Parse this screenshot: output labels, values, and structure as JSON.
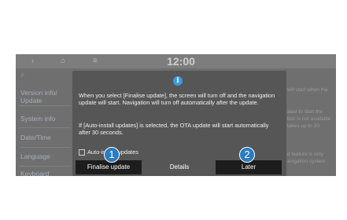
{
  "topbar": {
    "clock": "12:00",
    "back_icon": "chevron-left-icon",
    "home_icon": "home-icon",
    "menu_icon": "menu-icon"
  },
  "sidebar": {
    "search_icon": "search-icon",
    "items": [
      {
        "label": "Version info/",
        "label2": "Update"
      },
      {
        "label": "System info"
      },
      {
        "label": "Date/Time"
      },
      {
        "label": "Language"
      },
      {
        "label": "Keyboard"
      }
    ]
  },
  "background_text": {
    "line1": "will start when the",
    "line2": "ated to start the",
    "line3": "tion is not available",
    "line4": "takes up to 20",
    "line5": "d feature is only",
    "line6": "avigation system"
  },
  "dialog": {
    "icon": "info-icon",
    "message1": "When you select [Finalise update], the screen will turn off and the navigation update will start. Navigation will turn off automatically after the update.",
    "message2": "If [Auto-install updates] is selected, the OTA update will start automatically after 30 seconds.",
    "checkbox_label": "Auto-install updates",
    "checkbox_checked": false,
    "buttons": {
      "finalise": "Finalise update",
      "details": "Details",
      "later": "Later"
    }
  },
  "callouts": {
    "one": "1",
    "two": "2"
  },
  "colors": {
    "accent": "#3a9be3",
    "callout": "#2b7cc2",
    "screen_bg": "#6f6f6f",
    "dialog_bg": "#565656",
    "button_bg": "#1d1d1d"
  }
}
